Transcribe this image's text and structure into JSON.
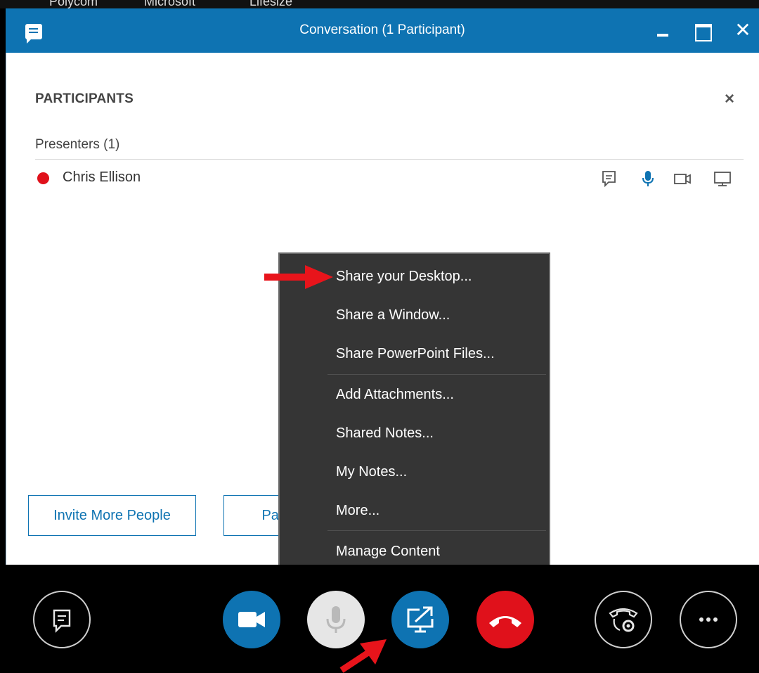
{
  "background": {
    "partial_text": [
      "Polycom",
      "Microsoft",
      "Lifesize"
    ]
  },
  "window": {
    "title": "Conversation (1 Participant)",
    "controls": {
      "close_glyph": "✕"
    }
  },
  "participants_panel": {
    "title": "PARTICIPANTS",
    "close_glyph": "×",
    "group_label": "Presenters (1)",
    "participant": {
      "name": "Chris Ellison",
      "status_color": "#e0111b"
    }
  },
  "buttons": {
    "invite": "Invite More People",
    "participant_actions": "Partic"
  },
  "share_menu": {
    "items": [
      "Share your Desktop...",
      "Share a Window...",
      "Share PowerPoint Files...",
      "Add Attachments...",
      "Shared Notes...",
      "My Notes...",
      "More...",
      "Manage Content"
    ]
  },
  "toolbar": {
    "icons": [
      "chat-icon",
      "video-icon",
      "microphone-icon",
      "present-icon",
      "hangup-icon",
      "call-controls-icon",
      "more-options-icon"
    ]
  },
  "colors": {
    "accent": "#0e73b2",
    "menu_bg": "#353535",
    "hangup": "#e0111b",
    "annotation_arrow": "#e8141b"
  }
}
